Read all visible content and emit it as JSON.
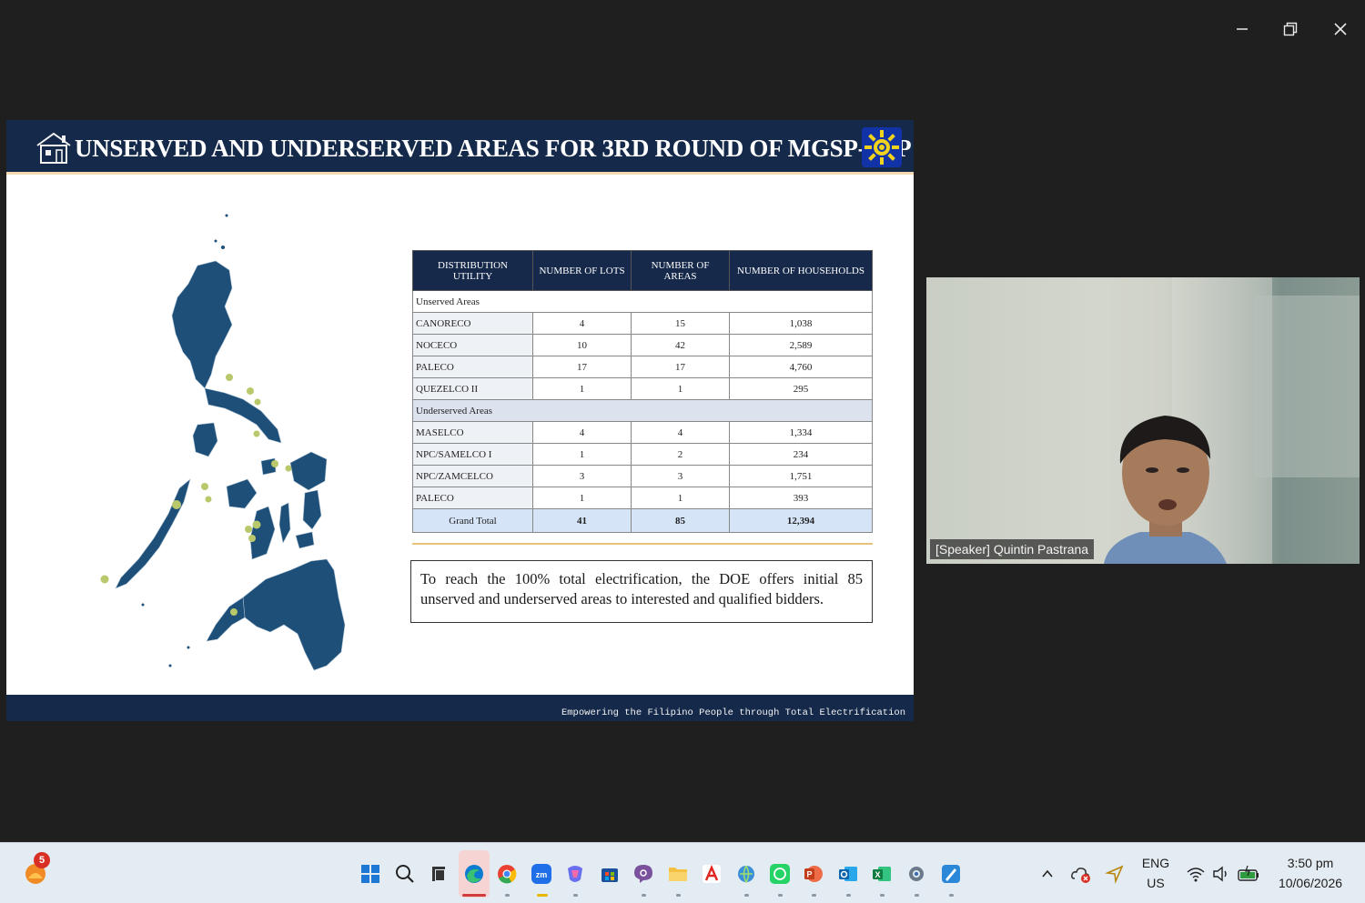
{
  "window": {
    "controls": [
      "minimize-icon",
      "restore-icon",
      "close-icon"
    ]
  },
  "slide": {
    "title": "UNSERVED AND UNDERSERVED AREAS FOR  3RD ROUND OF MGSP-CSP",
    "footer": "Empowering the Filipino People through Total Electrification",
    "table": {
      "headers": [
        "DISTRIBUTION UTILITY",
        "NUMBER OF LOTS",
        "NUMBER OF AREAS",
        "NUMBER OF HOUSEHOLDS"
      ],
      "section_unserved": "Unserved Areas",
      "unserved_rows": [
        {
          "utility": "CANORECO",
          "lots": "4",
          "areas": "15",
          "households": "1,038"
        },
        {
          "utility": "NOCECO",
          "lots": "10",
          "areas": "42",
          "households": "2,589"
        },
        {
          "utility": "PALECO",
          "lots": "17",
          "areas": "17",
          "households": "4,760"
        },
        {
          "utility": "QUEZELCO II",
          "lots": "1",
          "areas": "1",
          "households": "295"
        }
      ],
      "section_underserved": "Underserved Areas",
      "underserved_rows": [
        {
          "utility": "MASELCO",
          "lots": "4",
          "areas": "4",
          "households": "1,334"
        },
        {
          "utility": "NPC/SAMELCO I",
          "lots": "1",
          "areas": "2",
          "households": "234"
        },
        {
          "utility": "NPC/ZAMCELCO",
          "lots": "3",
          "areas": "3",
          "households": "1,751"
        },
        {
          "utility": "PALECO",
          "lots": "1",
          "areas": "1",
          "households": "393"
        }
      ],
      "total": {
        "label": "Grand Total",
        "lots": "41",
        "areas": "85",
        "households": "12,394"
      }
    },
    "note": "To reach the 100% total electrification, the DOE offers initial 85 unserved and underserved areas to interested and qualified bidders.",
    "colors": {
      "header": "#15294a",
      "map_fill": "#1d4f78",
      "map_dots": "#b9c86a"
    }
  },
  "video": {
    "speaker_label": "[Speaker] Quintin Pastrana"
  },
  "taskbar": {
    "notification_badge": "5",
    "apps": [
      "start-icon",
      "search-icon",
      "task-view-icon",
      "edge-icon",
      "chrome-icon",
      "zoom-icon",
      "copilot-icon",
      "store-icon",
      "viber-icon",
      "file-explorer-icon",
      "acrobat-icon",
      "vpn-icon",
      "whatsapp-icon",
      "powerpoint-icon",
      "outlook-icon",
      "excel-icon",
      "settings-icon",
      "paint-icon"
    ],
    "tray": {
      "language_top": "ENG",
      "language_bottom": "US",
      "time": "3:50 pm",
      "date": "10/06/2026"
    }
  }
}
